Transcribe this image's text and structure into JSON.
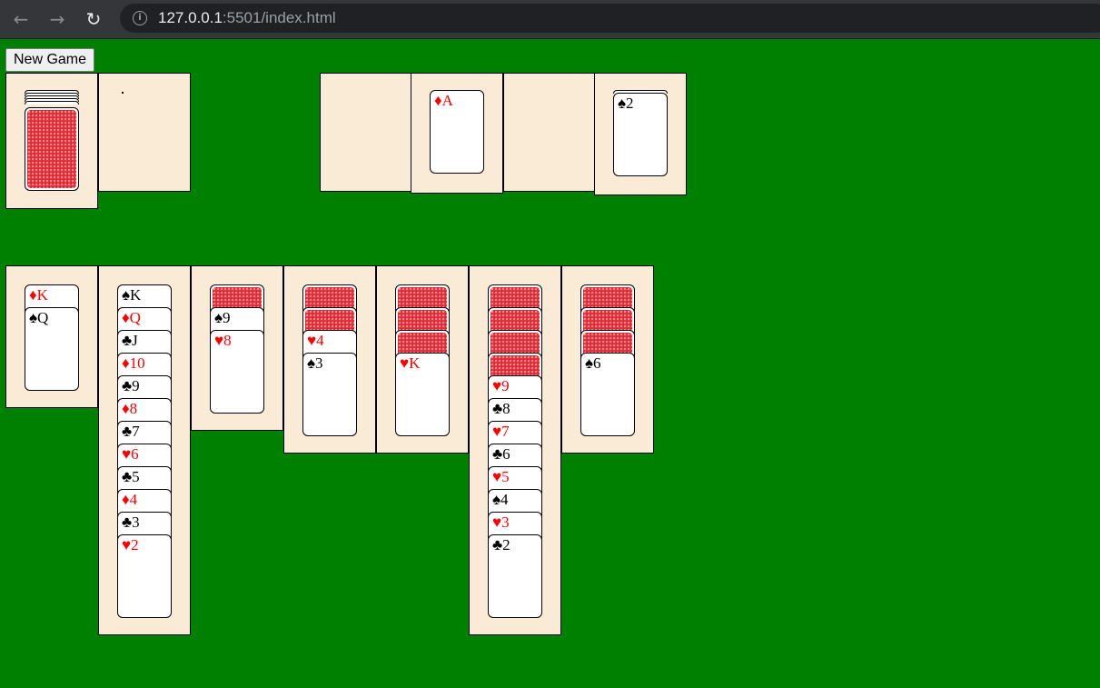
{
  "browser": {
    "back_icon": "←",
    "forward_icon": "→",
    "reload_icon": "↻",
    "info_icon": "i",
    "url_host": "127.0.0.1",
    "url_rest": ":5501/index.html"
  },
  "game": {
    "new_game_label": "New Game",
    "stock": {
      "stacked_card_edges": 5
    },
    "waste": {
      "cards": []
    },
    "foundations": [
      {
        "cards": []
      },
      {
        "cards": [
          {
            "rank": "A",
            "suit": "♦",
            "color": "red"
          }
        ]
      },
      {
        "cards": []
      },
      {
        "cards": [
          {
            "rank": "2",
            "suit": "♠",
            "color": "black"
          }
        ],
        "stacked_below": 1
      }
    ],
    "tableau": [
      {
        "facedown": 0,
        "cards": [
          {
            "rank": "K",
            "suit": "♦",
            "color": "red"
          },
          {
            "rank": "Q",
            "suit": "♠",
            "color": "black"
          }
        ]
      },
      {
        "facedown": 0,
        "cards": [
          {
            "rank": "K",
            "suit": "♠",
            "color": "black"
          },
          {
            "rank": "Q",
            "suit": "♦",
            "color": "red"
          },
          {
            "rank": "J",
            "suit": "♣",
            "color": "black"
          },
          {
            "rank": "10",
            "suit": "♦",
            "color": "red"
          },
          {
            "rank": "9",
            "suit": "♣",
            "color": "black"
          },
          {
            "rank": "8",
            "suit": "♦",
            "color": "red"
          },
          {
            "rank": "7",
            "suit": "♣",
            "color": "black"
          },
          {
            "rank": "6",
            "suit": "♥",
            "color": "red"
          },
          {
            "rank": "5",
            "suit": "♣",
            "color": "black"
          },
          {
            "rank": "4",
            "suit": "♦",
            "color": "red"
          },
          {
            "rank": "3",
            "suit": "♣",
            "color": "black"
          },
          {
            "rank": "2",
            "suit": "♥",
            "color": "red"
          }
        ]
      },
      {
        "facedown": 1,
        "cards": [
          {
            "rank": "9",
            "suit": "♠",
            "color": "black"
          },
          {
            "rank": "8",
            "suit": "♥",
            "color": "red"
          }
        ]
      },
      {
        "facedown": 2,
        "cards": [
          {
            "rank": "4",
            "suit": "♥",
            "color": "red"
          },
          {
            "rank": "3",
            "suit": "♠",
            "color": "black"
          }
        ]
      },
      {
        "facedown": 3,
        "cards": [
          {
            "rank": "K",
            "suit": "♥",
            "color": "red"
          }
        ]
      },
      {
        "facedown": 4,
        "cards": [
          {
            "rank": "9",
            "suit": "♥",
            "color": "red"
          },
          {
            "rank": "8",
            "suit": "♣",
            "color": "black"
          },
          {
            "rank": "7",
            "suit": "♥",
            "color": "red"
          },
          {
            "rank": "6",
            "suit": "♣",
            "color": "black"
          },
          {
            "rank": "5",
            "suit": "♥",
            "color": "red"
          },
          {
            "rank": "4",
            "suit": "♠",
            "color": "black"
          },
          {
            "rank": "3",
            "suit": "♥",
            "color": "red"
          },
          {
            "rank": "2",
            "suit": "♣",
            "color": "black"
          }
        ]
      },
      {
        "facedown": 3,
        "cards": [
          {
            "rank": "6",
            "suit": "♠",
            "color": "black"
          }
        ]
      }
    ]
  }
}
